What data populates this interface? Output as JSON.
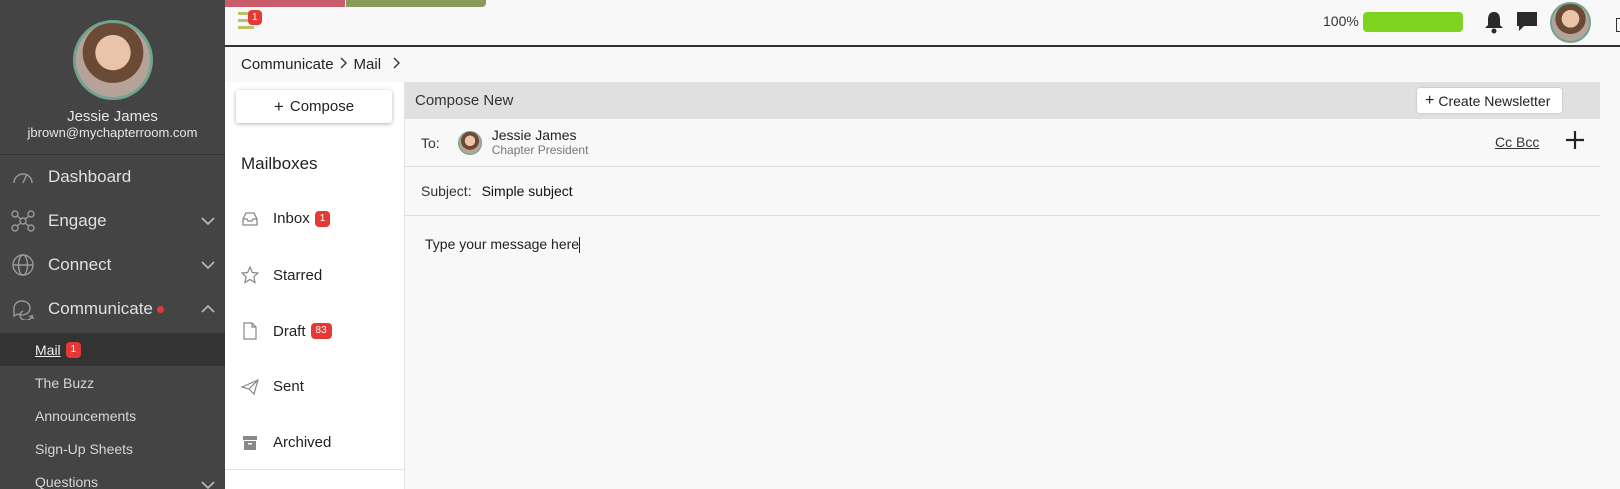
{
  "sidebar": {
    "user_name": "Jessie James",
    "user_email": "jbrown@mychapterroom.com",
    "nav": {
      "dashboard": "Dashboard",
      "engage": "Engage",
      "connect": "Connect",
      "communicate": "Communicate"
    },
    "sub": {
      "mail": "Mail",
      "mail_badge": "1",
      "buzz": "The Buzz",
      "announcements": "Announcements",
      "signup": "Sign-Up Sheets",
      "questions": "Questions"
    }
  },
  "topbar": {
    "menu_badge": "1",
    "progress_label": "100%",
    "progress_value": 1.0,
    "progress_color": "#7ed321"
  },
  "breadcrumb": {
    "items": [
      "Communicate",
      "Mail"
    ]
  },
  "mailboxes": {
    "compose_label": "Compose",
    "title": "Mailboxes",
    "inbox": "Inbox",
    "inbox_badge": "1",
    "starred": "Starred",
    "draft": "Draft",
    "draft_badge": "83",
    "sent": "Sent",
    "archived": "Archived"
  },
  "compose": {
    "header": "Compose New",
    "newsletter_label": "Create Newsletter",
    "to_label": "To:",
    "recipient_name": "Jessie James",
    "recipient_title": "Chapter President",
    "cc_bcc": "Cc Bcc",
    "subject_label": "Subject:",
    "subject_value": "Simple subject",
    "body_placeholder": "Type your message here"
  },
  "colors": {
    "sidebar_bg": "#444444",
    "badge_red": "#e53935",
    "compose_header_bg": "#e0e0e0"
  }
}
